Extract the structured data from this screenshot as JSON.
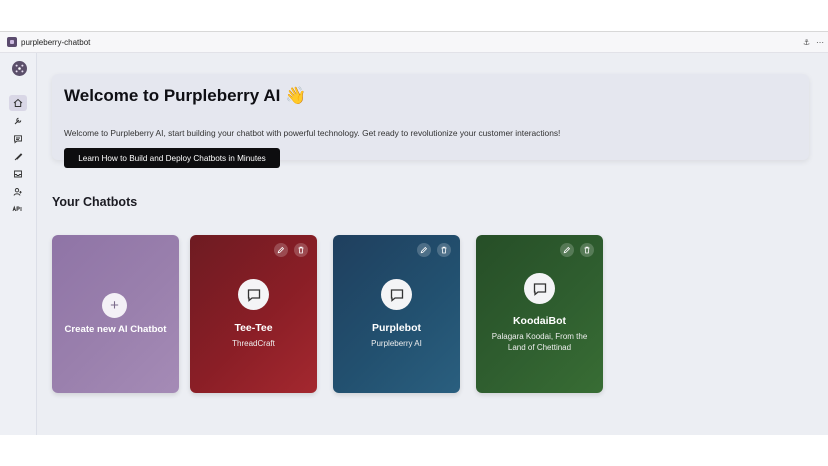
{
  "window": {
    "title": "purpleberry-chatbot",
    "actions": [
      "⚓",
      "⋯"
    ]
  },
  "sidebar": {
    "items": [
      "home",
      "tools",
      "chat",
      "brush",
      "inbox",
      "user-add",
      "api"
    ]
  },
  "hero": {
    "title": "Welcome to Purpleberry AI 👋",
    "subtitle": "Welcome to Purpleberry AI, start building your chatbot with powerful technology. Get ready to revolutionize your customer interactions!",
    "cta": "Learn How to Build and Deploy Chatbots in Minutes"
  },
  "section": {
    "title": "Your Chatbots"
  },
  "create_card": {
    "icon": "+",
    "label": "Create new AI Chatbot"
  },
  "bots": [
    {
      "name": "Tee-Tee",
      "subtitle": "ThreadCraft",
      "color": "#8a1e26"
    },
    {
      "name": "Purplebot",
      "subtitle": "Purpleberry AI",
      "color": "#22506f"
    },
    {
      "name": "KoodaiBot",
      "subtitle": "Palagara Koodai, From the Land of Chettinad",
      "color": "#2f5e2f"
    }
  ],
  "colors": {
    "accent": "#0d0d0f",
    "sidebar": "#eef0f5",
    "main_bg": "#eceef3"
  }
}
